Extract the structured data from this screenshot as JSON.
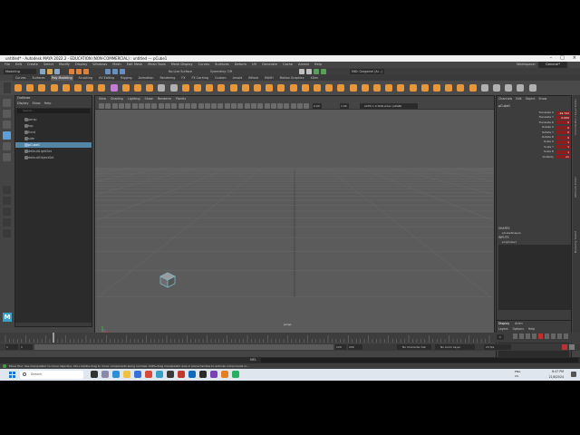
{
  "window": {
    "title": "untitled* - Autodesk MAYA 2022.2 - EDUCATION (NON-COMMERCIAL) : untitled --- pCube1"
  },
  "menus": [
    "File",
    "Edit",
    "Create",
    "Select",
    "Modify",
    "Display",
    "Windows",
    "Mesh",
    "Edit Mesh",
    "Mesh Tools",
    "Mesh Display",
    "Curves",
    "Surfaces",
    "Deform",
    "UV",
    "Generate",
    "Cache",
    "Arnold",
    "Help"
  ],
  "workspace": {
    "label": "Workspace:",
    "value": "General*"
  },
  "status_line": {
    "mode": "Modeling",
    "live_surface": "No Live Surface",
    "symmetry": "Symmetry: Off",
    "renderer": "MtD: Gargamel (Ar...)"
  },
  "shelf_tabs": [
    "Curves",
    "Surfaces",
    "Poly Modeling",
    "Sculpting",
    "UV Editing",
    "Rigging",
    "Animation",
    "Rendering",
    "FX",
    "FX Caching",
    "Custom",
    "Arnold",
    "Bifrost",
    "MASH",
    "Motion Graphics",
    "XGen"
  ],
  "outliner": {
    "title": "Outliner",
    "menus": [
      "Display",
      "Show",
      "Help"
    ],
    "search_placeholder": "Search...",
    "items": [
      "persp",
      "top",
      "front",
      "side",
      "pCube1",
      "defaultLightSet",
      "defaultObjectSet"
    ]
  },
  "viewport": {
    "menus": [
      "View",
      "Shading",
      "Lighting",
      "Show",
      "Renderer",
      "Panels"
    ],
    "field_a": "0.00",
    "field_b": "1.00",
    "camera": "ACES 1.0 SDR-video (sRGB)",
    "camera_label": "persp"
  },
  "channel_box": {
    "tabs": [
      "Channels",
      "Edit",
      "Object",
      "Show"
    ],
    "object": "pCube1",
    "channels": [
      {
        "name": "Translate X",
        "value": "-19.722"
      },
      {
        "name": "Translate Y",
        "value": "0.000"
      },
      {
        "name": "Translate Z",
        "value": "0"
      },
      {
        "name": "Rotate X",
        "value": "0"
      },
      {
        "name": "Rotate Y",
        "value": "0"
      },
      {
        "name": "Rotate Z",
        "value": "0"
      },
      {
        "name": "Scale X",
        "value": "1"
      },
      {
        "name": "Scale Y",
        "value": "1"
      },
      {
        "name": "Scale Z",
        "value": "1"
      },
      {
        "name": "Visibility",
        "value": "on"
      }
    ],
    "shapes_label": "SHAPES",
    "shape_name": "pCubeShape1",
    "inputs_label": "INPUTS",
    "input_name": "polyCube1"
  },
  "layers": {
    "tabs": [
      "Display",
      "Anim"
    ],
    "menus": [
      "Layers",
      "Options",
      "Help"
    ]
  },
  "vertical_tabs": [
    "Channel Box / Layer Editor",
    "Attribute Editor",
    "Modeling Toolkit"
  ],
  "time_slider": {
    "start": "1",
    "current": "1",
    "end": "120",
    "range_end": "120",
    "range_max": "200"
  },
  "playback": {
    "character_set": "No Character Set",
    "anim_layer": "No Anim Layer",
    "fps": "24 fps"
  },
  "command_line": {
    "label": "MEL"
  },
  "help_line": "Move Tool: Use manipulator to move object(s). Ctrl+middle-drag to move components along normals. Shift+drag manipulator axis or plane handles to extrude components or...",
  "taskbar": {
    "search": "Search",
    "language": "ENG",
    "region": "US",
    "time": "8:47 PM",
    "date": "21/8/2024"
  },
  "colors": {
    "selection": "#5285a6",
    "keyed": "#8a1e1e",
    "viewport": "#5b5b5b",
    "grid": "#6a6a6a",
    "cube": "#7fb7c4"
  },
  "icons": [
    "maya-logo",
    "select-tool",
    "lasso-tool",
    "paint-tool",
    "move-tool",
    "rotate-tool",
    "scale-tool",
    "windows-start",
    "search-icon"
  ]
}
